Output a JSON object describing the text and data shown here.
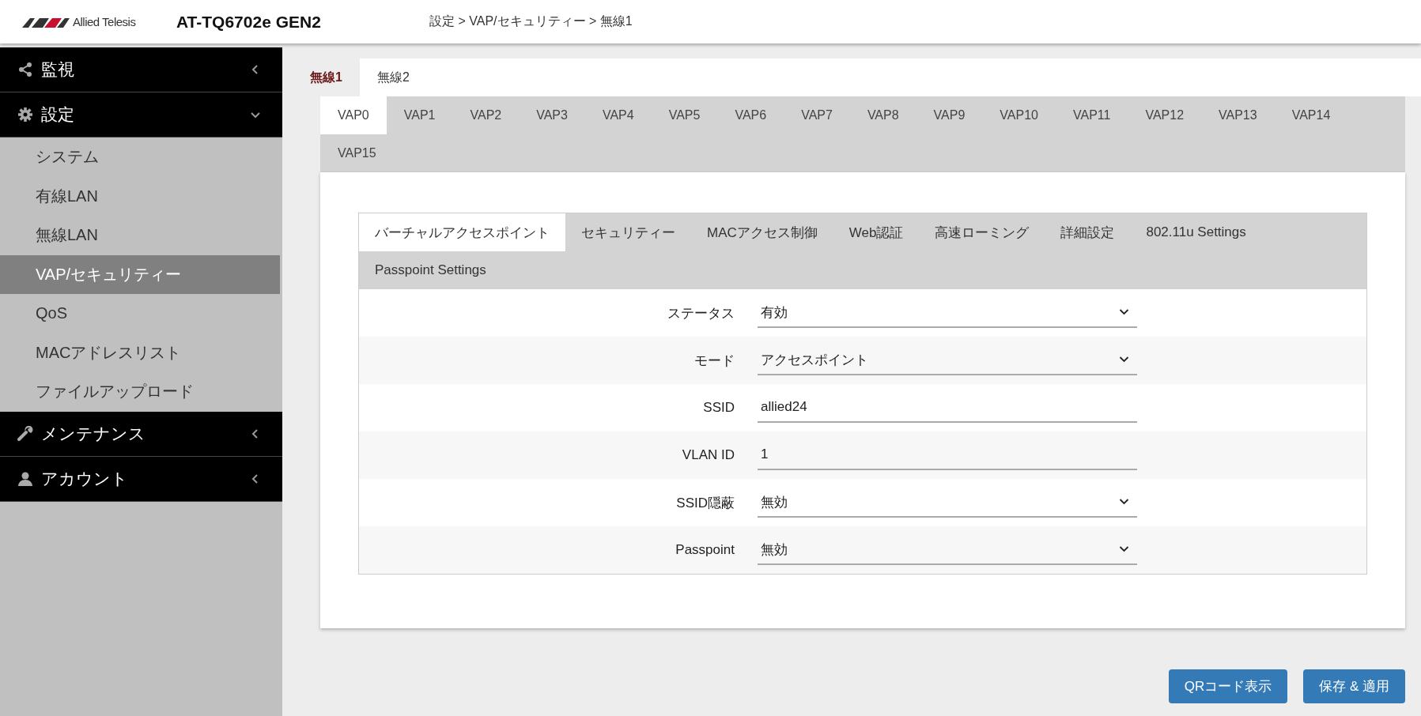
{
  "header": {
    "logo": "Allied Telesis",
    "model": "AT-TQ6702e GEN2",
    "breadcrumb": "設定 > VAP/セキュリティー > 無線1"
  },
  "sidebar": {
    "items": [
      {
        "label": "監視",
        "expanded": false
      },
      {
        "label": "設定",
        "expanded": true,
        "children": [
          {
            "label": "システム",
            "selected": false
          },
          {
            "label": "有線LAN",
            "selected": false
          },
          {
            "label": "無線LAN",
            "selected": false
          },
          {
            "label": "VAP/セキュリティー",
            "selected": true
          },
          {
            "label": "QoS",
            "selected": false
          },
          {
            "label": "MACアドレスリスト",
            "selected": false
          },
          {
            "label": "ファイルアップロード",
            "selected": false
          }
        ]
      },
      {
        "label": "メンテナンス",
        "expanded": false
      },
      {
        "label": "アカウント",
        "expanded": false
      }
    ]
  },
  "radio_tabs": [
    {
      "label": "無線1",
      "selected": true
    },
    {
      "label": "無線2",
      "selected": false
    }
  ],
  "vap_tabs": [
    {
      "label": "VAP0",
      "selected": true
    },
    {
      "label": "VAP1",
      "selected": false
    },
    {
      "label": "VAP2",
      "selected": false
    },
    {
      "label": "VAP3",
      "selected": false
    },
    {
      "label": "VAP4",
      "selected": false
    },
    {
      "label": "VAP5",
      "selected": false
    },
    {
      "label": "VAP6",
      "selected": false
    },
    {
      "label": "VAP7",
      "selected": false
    },
    {
      "label": "VAP8",
      "selected": false
    },
    {
      "label": "VAP9",
      "selected": false
    },
    {
      "label": "VAP10",
      "selected": false
    },
    {
      "label": "VAP11",
      "selected": false
    },
    {
      "label": "VAP12",
      "selected": false
    },
    {
      "label": "VAP13",
      "selected": false
    },
    {
      "label": "VAP14",
      "selected": false
    },
    {
      "label": "VAP15",
      "selected": false
    }
  ],
  "section_tabs": [
    {
      "label": "バーチャルアクセスポイント",
      "selected": true
    },
    {
      "label": "セキュリティー",
      "selected": false
    },
    {
      "label": "MACアクセス制御",
      "selected": false
    },
    {
      "label": "Web認証",
      "selected": false
    },
    {
      "label": "高速ローミング",
      "selected": false
    },
    {
      "label": "詳細設定",
      "selected": false
    },
    {
      "label": "802.11u Settings",
      "selected": false
    },
    {
      "label": "Passpoint Settings",
      "selected": false
    }
  ],
  "form": [
    {
      "label": "ステータス",
      "kind": "select",
      "value": "有効"
    },
    {
      "label": "モード",
      "kind": "select",
      "value": "アクセスポイント"
    },
    {
      "label": "SSID",
      "kind": "text",
      "value": "allied24"
    },
    {
      "label": "VLAN ID",
      "kind": "text",
      "value": "1"
    },
    {
      "label": "SSID隠蔽",
      "kind": "select",
      "value": "無効"
    },
    {
      "label": "Passpoint",
      "kind": "select",
      "value": "無効"
    }
  ],
  "buttons": [
    "QRコード表示",
    "保存 & 適用"
  ]
}
